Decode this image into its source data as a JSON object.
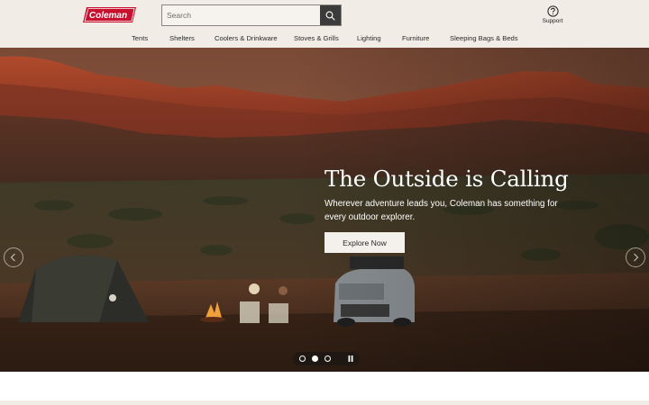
{
  "brand": {
    "logo_text": "Coleman"
  },
  "search": {
    "placeholder": "Search"
  },
  "support": {
    "label": "Support"
  },
  "nav": {
    "items": [
      {
        "label": "Tents"
      },
      {
        "label": "Shelters"
      },
      {
        "label": "Coolers & Drinkware"
      },
      {
        "label": "Stoves & Grills"
      },
      {
        "label": "Lighting"
      },
      {
        "label": "Furniture"
      },
      {
        "label": "Sleeping Bags & Beds"
      }
    ]
  },
  "hero": {
    "headline": "The Outside is Calling",
    "subtext": "Wherever adventure leads you, Coleman has something for every outdoor explorer.",
    "cta_label": "Explore Now",
    "slide_count": 3,
    "active_slide": 2
  },
  "colors": {
    "brand_red": "#c8102e",
    "header_bg": "#f1ede6",
    "search_button": "#3b3b3b"
  }
}
